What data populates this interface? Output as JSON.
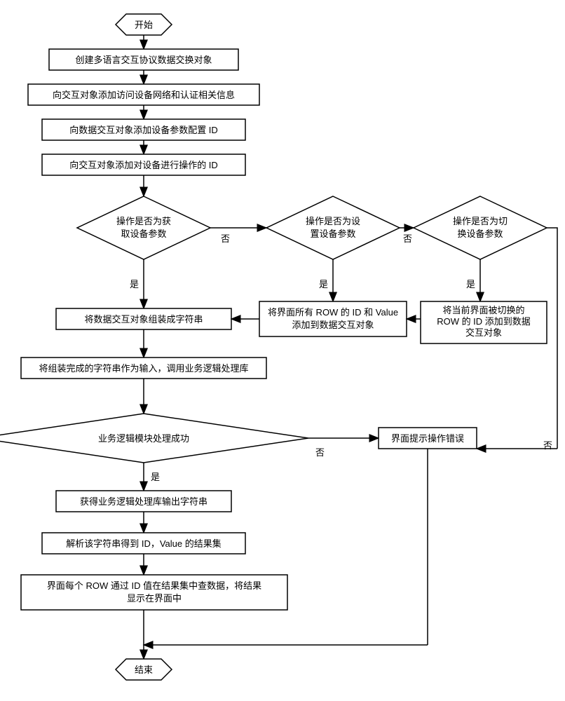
{
  "chart_data": {
    "type": "flowchart",
    "nodes": [
      {
        "id": "start",
        "type": "terminal",
        "label": "开始"
      },
      {
        "id": "n1",
        "type": "process",
        "label": "创建多语言交互协议数据交换对象"
      },
      {
        "id": "n2",
        "type": "process",
        "label": "向交互对象添加访问设备网络和认证相关信息"
      },
      {
        "id": "n3",
        "type": "process",
        "label": "向数据交互对象添加设备参数配置 ID"
      },
      {
        "id": "n4",
        "type": "process",
        "label": "向交互对象添加对设备进行操作的 ID"
      },
      {
        "id": "d1",
        "type": "decision",
        "label": "操作是否为获取设备参数"
      },
      {
        "id": "d2",
        "type": "decision",
        "label": "操作是否为设置设备参数"
      },
      {
        "id": "d3",
        "type": "decision",
        "label": "操作是否为切换设备参数"
      },
      {
        "id": "n5",
        "type": "process",
        "label": "将数据交互对象组装成字符串"
      },
      {
        "id": "n6",
        "type": "process",
        "label": "将界面所有 ROW 的 ID 和 Value 添加到数据交互对象"
      },
      {
        "id": "n7",
        "type": "process",
        "label": "将当前界面被切换的 ROW 的 ID 添加到数据交互对象"
      },
      {
        "id": "n8",
        "type": "process",
        "label": "将组装完成的字符串作为输入，调用业务逻辑处理库"
      },
      {
        "id": "d4",
        "type": "decision",
        "label": "业务逻辑模块处理成功"
      },
      {
        "id": "n9",
        "type": "process",
        "label": "界面提示操作错误"
      },
      {
        "id": "n10",
        "type": "process",
        "label": "获得业务逻辑处理库输出字符串"
      },
      {
        "id": "n11",
        "type": "process",
        "label": "解析该字符串得到 ID，Value 的结果集"
      },
      {
        "id": "n12",
        "type": "process",
        "label": "界面每个 ROW 通过 ID 值在结果集中查数据，将结果显示在界面中"
      },
      {
        "id": "end",
        "type": "terminal",
        "label": "结束"
      }
    ],
    "edges": [
      {
        "from": "start",
        "to": "n1"
      },
      {
        "from": "n1",
        "to": "n2"
      },
      {
        "from": "n2",
        "to": "n3"
      },
      {
        "from": "n3",
        "to": "n4"
      },
      {
        "from": "n4",
        "to": "d1"
      },
      {
        "from": "d1",
        "to": "n5",
        "label": "是"
      },
      {
        "from": "d1",
        "to": "d2",
        "label": "否"
      },
      {
        "from": "d2",
        "to": "n6",
        "label": "是"
      },
      {
        "from": "d2",
        "to": "d3",
        "label": "否"
      },
      {
        "from": "d3",
        "to": "n7",
        "label": "是"
      },
      {
        "from": "d3",
        "to": "n9",
        "label": "否"
      },
      {
        "from": "n6",
        "to": "n5"
      },
      {
        "from": "n7",
        "to": "n5"
      },
      {
        "from": "n5",
        "to": "n8"
      },
      {
        "from": "n8",
        "to": "d4"
      },
      {
        "from": "d4",
        "to": "n10",
        "label": "是"
      },
      {
        "from": "d4",
        "to": "n9",
        "label": "否"
      },
      {
        "from": "n10",
        "to": "n11"
      },
      {
        "from": "n11",
        "to": "n12"
      },
      {
        "from": "n12",
        "to": "end"
      },
      {
        "from": "n9",
        "to": "end"
      }
    ]
  },
  "labels": {
    "yes": "是",
    "no": "否"
  }
}
